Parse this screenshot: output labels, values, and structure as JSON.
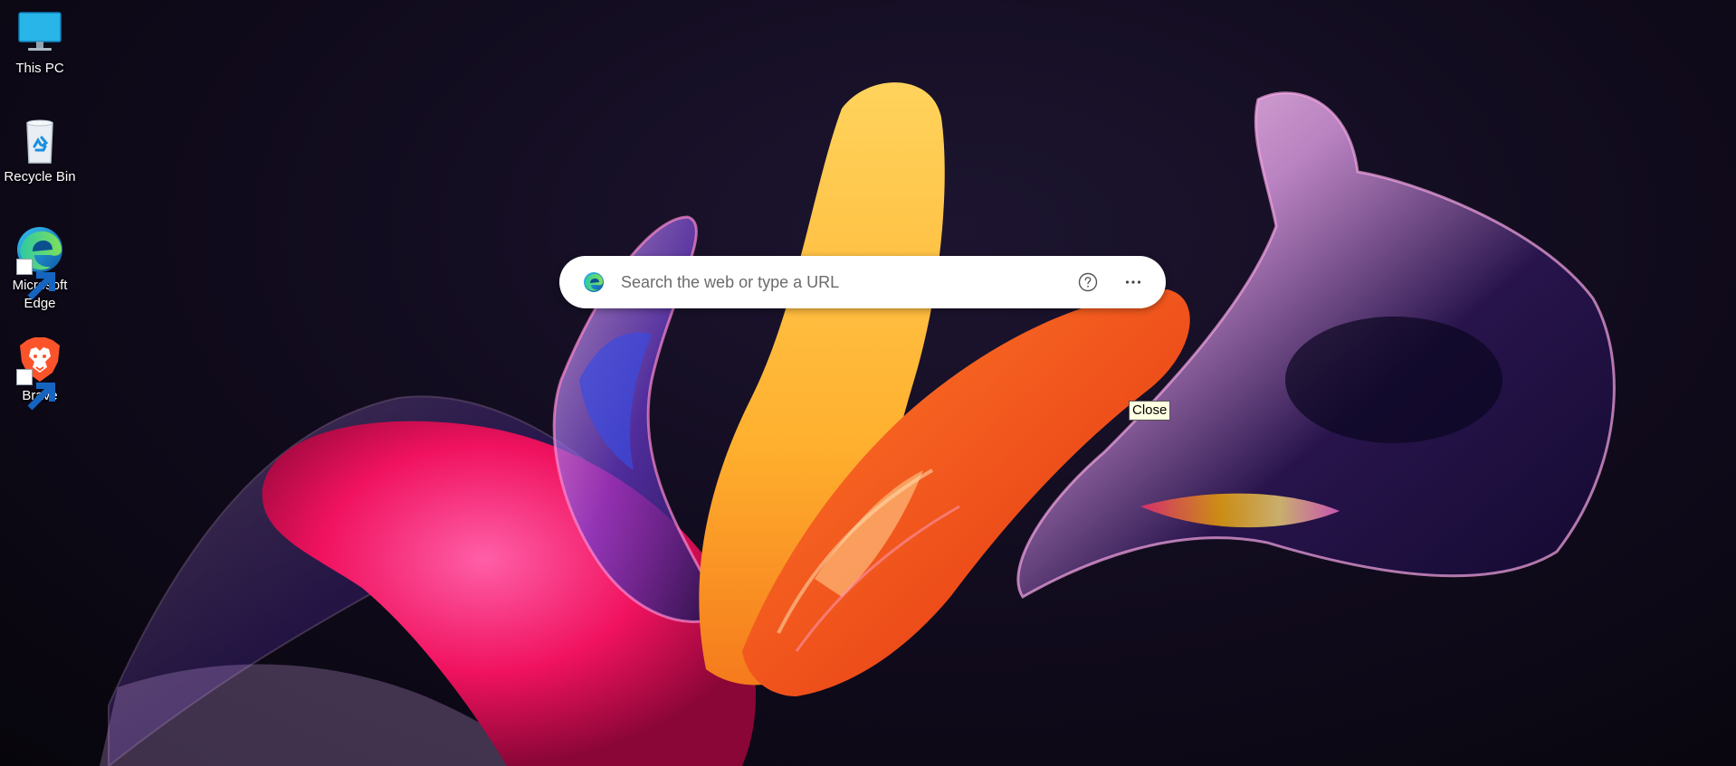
{
  "desktop": {
    "icons": [
      {
        "label": "This PC",
        "icon": "monitor-icon"
      },
      {
        "label": "Recycle Bin",
        "icon": "recycle-bin-icon"
      },
      {
        "label": "Microsoft Edge",
        "icon": "edge-icon"
      },
      {
        "label": "Brave",
        "icon": "brave-lion-icon"
      }
    ]
  },
  "search": {
    "placeholder": "Search the web or type a URL",
    "value": ""
  },
  "tooltip": {
    "text": "Close"
  },
  "colors": {
    "background": "#0b0714",
    "edge_blue": "#0c59a4",
    "edge_green": "#2fc9a2",
    "brave_orange": "#fb542b",
    "searchbar": "#ffffff",
    "tooltip_bg": "#ffffe1"
  }
}
